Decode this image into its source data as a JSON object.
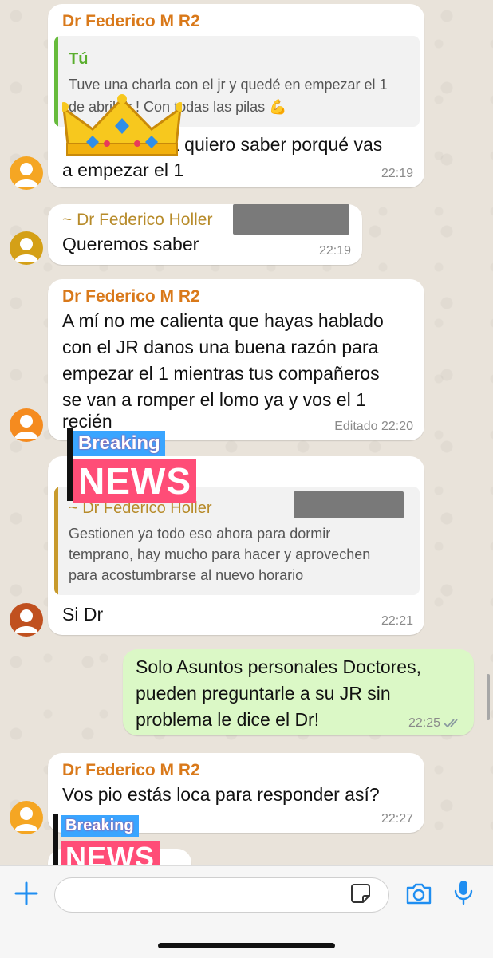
{
  "colors": {
    "accent": "#1f8ef1",
    "sender_orange": "#d9791a",
    "outgoing_bubble": "#dbf8c6",
    "tick_blue": "#53bdeb"
  },
  "messages": [
    {
      "sender": "Dr Federico M R2",
      "quote": {
        "name": "Tú",
        "text_line1": "Tuve una charla con el jr y quedé en empezar el 1",
        "text_line2": "de abril dr.! Con todas las pilas 💪"
      },
      "text_line1_tail": "a quiero saber porqué vas",
      "text_line2": "a empezar el 1",
      "time": "22:19"
    },
    {
      "sender": "~ Dr Federico Holler",
      "text": "Queremos saber",
      "time": "22:19"
    },
    {
      "sender": "Dr Federico M R2",
      "lines": [
        "A mí no me calienta que hayas hablado",
        "con el JR danos una buena razón para",
        "empezar el 1 mientras tus compañeros",
        "se van a romper el lomo ya y vos el 1",
        "recién"
      ],
      "edited": "Editado",
      "time": "22:20"
    },
    {
      "quote": {
        "name": "~ Dr Federico Holler",
        "lines": [
          "Gestionen ya todo eso ahora para dormir",
          "temprano, hay mucho para hacer y aprovechen",
          "para acostumbrarse al nuevo horario"
        ]
      },
      "text": "Si Dr",
      "time": "22:21"
    },
    {
      "outgoing": true,
      "lines": [
        "Solo Asuntos personales Doctores,",
        "pueden preguntarle a su JR sin",
        "problema le dice el Dr!"
      ],
      "time": "22:25"
    },
    {
      "sender": "Dr Federico M R2",
      "text": "Vos pio estás loca para responder así?",
      "time": "22:27"
    }
  ],
  "stickers": {
    "breaking": "Breaking",
    "news": "NEWS"
  },
  "input": {
    "placeholder": ""
  },
  "icons": {
    "add": "plus-icon",
    "sticker": "sticker-icon",
    "camera": "camera-icon",
    "mic": "microphone-icon"
  }
}
